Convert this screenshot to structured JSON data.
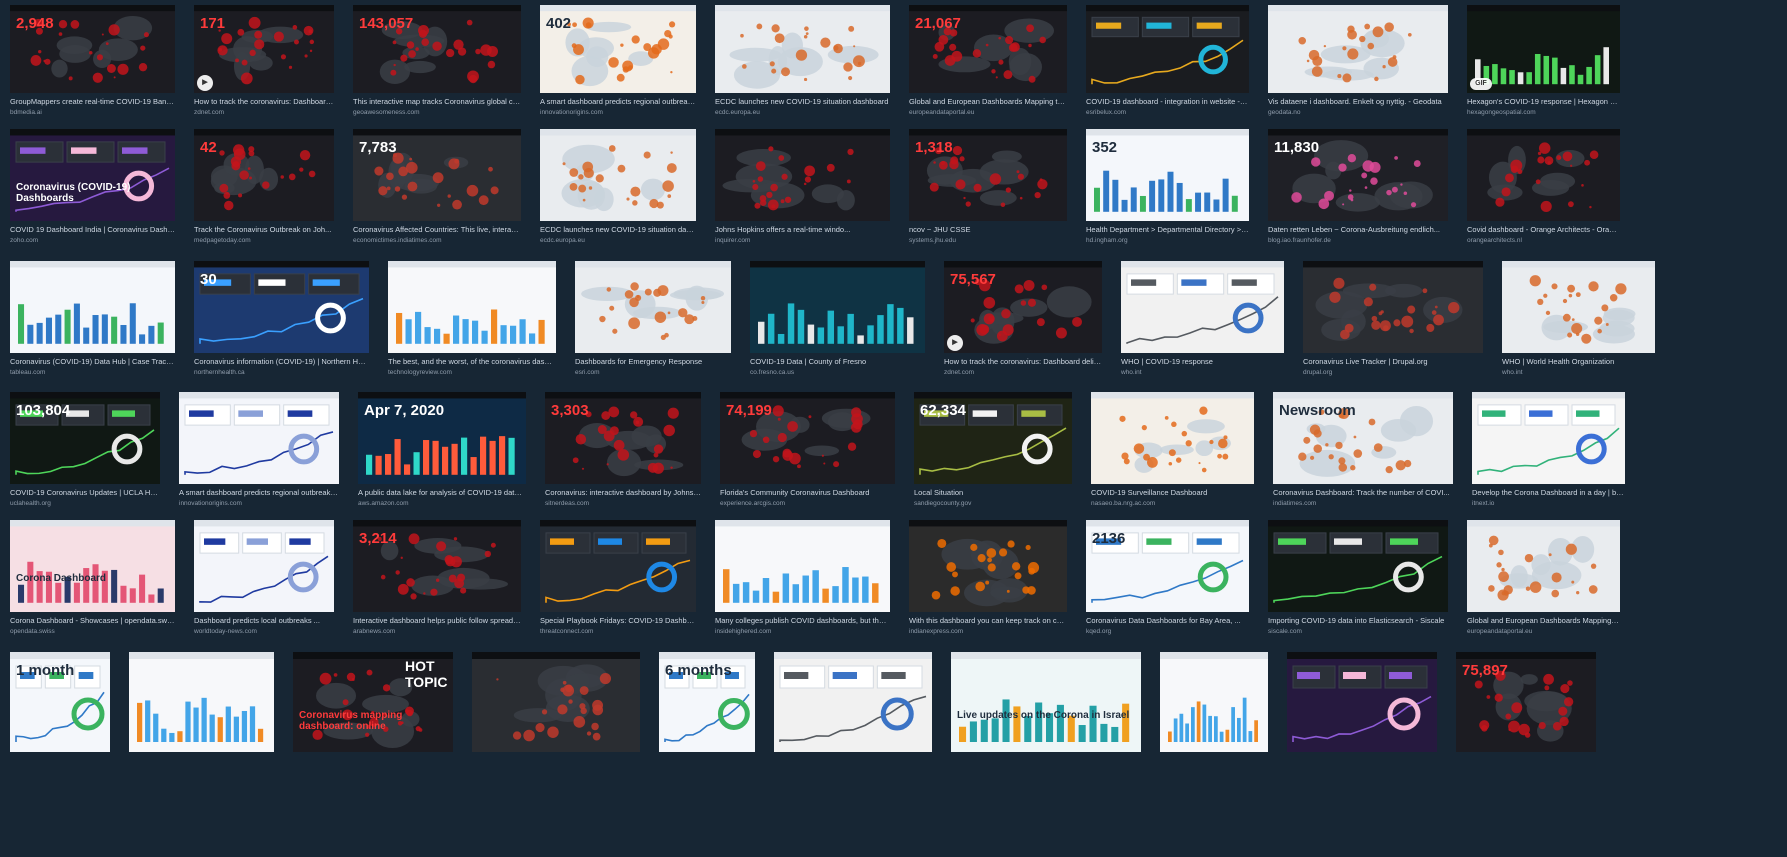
{
  "rows": [
    [
      {
        "caption": "GroupMappers create real-time COVID-19 Banglad...",
        "source": "bdmedia.ai",
        "palette": "dark-red",
        "overlay": "2,948"
      },
      {
        "caption": "How to track the coronavirus: Dashboard d...",
        "source": "zdnet.com",
        "palette": "dark-red",
        "overlay": "171",
        "badge": "play"
      },
      {
        "caption": "This interactive map tracks Coronavirus global case...",
        "source": "geoawesomeness.com",
        "palette": "dark-red",
        "overlay": "143,057"
      },
      {
        "caption": "A smart dashboard predicts regional outbreaks ...",
        "source": "innovationorigins.com",
        "palette": "light-orange",
        "overlay": "402"
      },
      {
        "caption": "ECDC launches new COVID-19 situation dashboard",
        "source": "ecdc.europa.eu",
        "palette": "light-map",
        "overlay": ""
      },
      {
        "caption": "Global and European Dashboards Mapping the S...",
        "source": "europeandataportal.eu",
        "palette": "dark-red",
        "overlay": "21,067"
      },
      {
        "caption": "COVID-19 dashboard - integration in website - Esri B...",
        "source": "esribelux.com",
        "palette": "dark-chart",
        "overlay": ""
      },
      {
        "caption": "Vis dataene i dashboard. Enkelt og nyttig. - Geodata",
        "source": "geodata.no",
        "palette": "light-map",
        "overlay": ""
      },
      {
        "caption": "Hexagon's COVID-19 response | Hexagon Geos...",
        "source": "hexagongeospatial.com",
        "palette": "dark-green",
        "overlay": "",
        "badge": "gif"
      }
    ],
    [
      {
        "caption": "COVID 19 Dashboard India | Coronavirus Dashboard (...",
        "source": "zoho.com",
        "palette": "dark-purple",
        "overlay": "Coronavirus (COVID-19) Dashboards"
      },
      {
        "caption": "Track the Coronavirus Outbreak on Joh...",
        "source": "medpagetoday.com",
        "palette": "dark-red",
        "overlay": "42"
      },
      {
        "caption": "Coronavirus Affected Countries: This live, interactive da...",
        "source": "economictimes.indiatimes.com",
        "palette": "dark-grey",
        "overlay": "7,783"
      },
      {
        "caption": "ECDC launches new COVID-19 situation dashb...",
        "source": "ecdc.europa.eu",
        "palette": "light-map",
        "overlay": ""
      },
      {
        "caption": "Johns Hopkins offers a real-time windo...",
        "source": "inquirer.com",
        "palette": "dark-red",
        "overlay": ""
      },
      {
        "caption": "ncov ~ JHU CSSE",
        "source": "systems.jhu.edu",
        "palette": "dark-red",
        "overlay": "1,318"
      },
      {
        "caption": "Health Department > Departmental Directory > Communic...",
        "source": "hd.ingham.org",
        "palette": "light-blue",
        "overlay": "352"
      },
      {
        "caption": "Daten retten Leben ~ Corona-Ausbreitung endlich...",
        "source": "blog.iao.fraunhofer.de",
        "palette": "dark-pink",
        "overlay": "11,830"
      },
      {
        "caption": "Covid dashboard - Orange Architects - Orange Archit...",
        "source": "orangearchitects.nl",
        "palette": "dark-red",
        "overlay": ""
      }
    ],
    [
      {
        "caption": "Coronavirus (COVID-19) Data Hub | Case Tracker, ...",
        "source": "tableau.com",
        "palette": "light-blue",
        "overlay": ""
      },
      {
        "caption": "Coronavirus information (COVID-19) | Northern Health",
        "source": "northernhealth.ca",
        "palette": "navy",
        "overlay": "30"
      },
      {
        "caption": "The best, and the worst, of the coronavirus dashboar...",
        "source": "technologyreview.com",
        "palette": "light-bars",
        "overlay": ""
      },
      {
        "caption": "Dashboards for Emergency Response",
        "source": "esri.com",
        "palette": "light-map",
        "overlay": ""
      },
      {
        "caption": "COVID-19 Data | County of Fresno",
        "source": "co.fresno.ca.us",
        "palette": "dark-teal",
        "overlay": ""
      },
      {
        "caption": "How to track the coronavirus: Dashboard delivers r...",
        "source": "zdnet.com",
        "palette": "dark-red",
        "overlay": "75,567",
        "badge": "play"
      },
      {
        "caption": "WHO | COVID-19 response",
        "source": "who.int",
        "palette": "light-grey",
        "overlay": ""
      },
      {
        "caption": "Coronavirus Live Tracker | Drupal.org",
        "source": "drupal.org",
        "palette": "dark-grey",
        "overlay": ""
      },
      {
        "caption": "WHO | World Health Organization",
        "source": "who.int",
        "palette": "light-map",
        "overlay": ""
      }
    ],
    [
      {
        "caption": "COVID-19 Coronavirus Updates | UCLA Healt...",
        "source": "uclahealth.org",
        "palette": "dark-green",
        "overlay": "103,804"
      },
      {
        "caption": "A smart dashboard predicts regional outbreaks of...",
        "source": "innovationorigins.com",
        "palette": "light-network",
        "overlay": ""
      },
      {
        "caption": "A public data lake for analysis of COVID-19 data ...",
        "source": "aws.amazon.com",
        "palette": "dark-navy",
        "overlay": "Apr 7, 2020"
      },
      {
        "caption": "Coronavirus: interactive dashboard by Johns ...",
        "source": "sitnerdeas.com",
        "palette": "dark-red",
        "overlay": "3,303"
      },
      {
        "caption": "Florida's Community Coronavirus Dashboard",
        "source": "experience.arcgis.com",
        "palette": "dark-red",
        "overlay": "74,199"
      },
      {
        "caption": "Local Situation",
        "source": "sandiegocounty.gov",
        "palette": "dark-olive",
        "overlay": "62,334"
      },
      {
        "caption": "COVID-19 Surveillance Dashboard",
        "source": "nasaeo.ba.nrg.ac.com",
        "palette": "light-orange",
        "overlay": ""
      },
      {
        "caption": "Coronavirus Dashboard: Track the number of COVI...",
        "source": "indiatimes.com",
        "palette": "light-map",
        "overlay": "Newsroom"
      },
      {
        "caption": "Develop the Corona Dashboard in a day | by I...",
        "source": "itnext.io",
        "palette": "light-tiles",
        "overlay": ""
      }
    ],
    [
      {
        "caption": "Corona Dashboard - Showcases | opendata.swiss",
        "source": "opendata.swiss",
        "palette": "pink-phone",
        "overlay": "Corona Dashboard"
      },
      {
        "caption": "Dashboard predicts local outbreaks ...",
        "source": "worldtoday-news.com",
        "palette": "light-network",
        "overlay": ""
      },
      {
        "caption": "Interactive dashboard helps public follow spread ...",
        "source": "arabnews.com",
        "palette": "dark-red",
        "overlay": "3,214"
      },
      {
        "caption": "Special Playbook Fridays: COVID-19 Dashboard, Metri...",
        "source": "threatconnect.com",
        "palette": "dark-blocks",
        "overlay": ""
      },
      {
        "caption": "Many colleges publish COVID dashboards, but there's ...",
        "source": "insidehighered.com",
        "palette": "light-bars",
        "overlay": ""
      },
      {
        "caption": "With this dashboard you can keep track on coronavi...",
        "source": "indianexpress.com",
        "palette": "dark-map",
        "overlay": ""
      },
      {
        "caption": "Coronavirus Data Dashboards for Bay Area, ...",
        "source": "kqed.org",
        "palette": "light-blue",
        "overlay": "2136"
      },
      {
        "caption": "Importing COVID-19 data into Elasticsearch - Siscale",
        "source": "siscale.com",
        "palette": "dark-green",
        "overlay": ""
      },
      {
        "caption": "Global and European Dashboards Mapping the Spread of ...",
        "source": "europeandataportal.eu",
        "palette": "light-map",
        "overlay": ""
      }
    ],
    [
      {
        "caption": "",
        "source": "",
        "palette": "light-blue",
        "overlay": "1 month"
      },
      {
        "caption": "",
        "source": "",
        "palette": "light-bars",
        "overlay": ""
      },
      {
        "caption": "",
        "source": "",
        "palette": "dark-red",
        "overlay": "Coronavirus mapping dashboard: online",
        "hot": "HOT TOPIC"
      },
      {
        "caption": "",
        "source": "",
        "palette": "dark-grey",
        "overlay": ""
      },
      {
        "caption": "",
        "source": "",
        "palette": "light-blue",
        "overlay": "6 months"
      },
      {
        "caption": "",
        "source": "",
        "palette": "light-grey",
        "overlay": ""
      },
      {
        "caption": "",
        "source": "",
        "palette": "light-teal",
        "overlay": "Live updates on the Corona in Israel"
      },
      {
        "caption": "",
        "source": "",
        "palette": "light-bars",
        "overlay": ""
      },
      {
        "caption": "",
        "source": "",
        "palette": "dark-purple",
        "overlay": ""
      },
      {
        "caption": "",
        "source": "",
        "palette": "dark-red",
        "overlay": "75,897"
      }
    ]
  ]
}
